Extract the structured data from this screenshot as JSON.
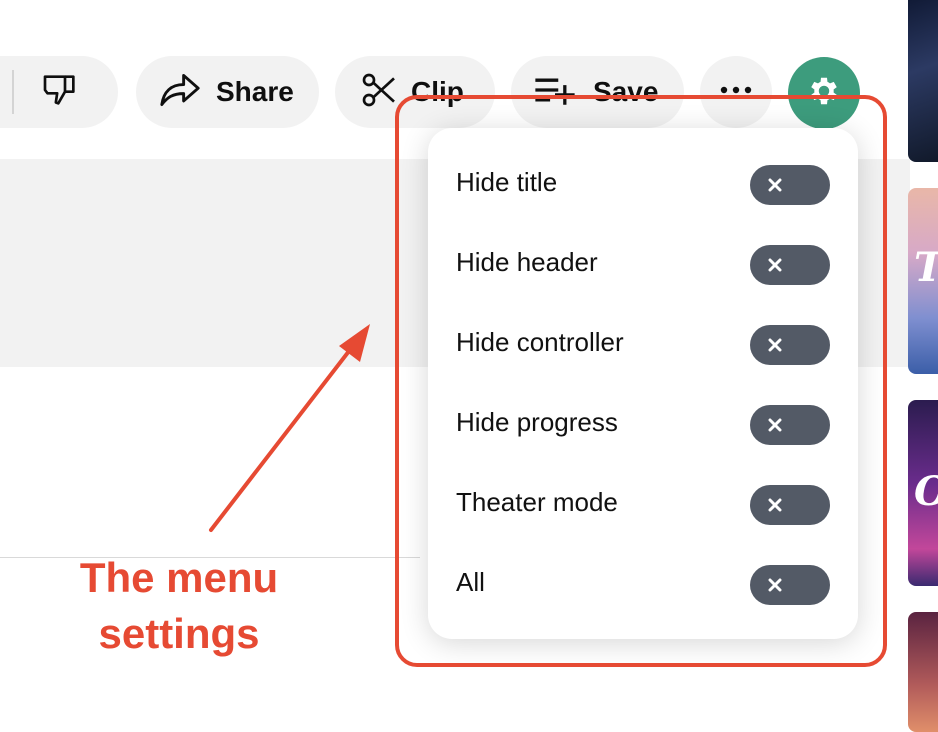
{
  "toolbar": {
    "share_label": "Share",
    "clip_label": "Clip",
    "save_label": "Save"
  },
  "thumbnails": [
    {
      "text": ""
    },
    {
      "text": "T"
    },
    {
      "text": "O"
    },
    {
      "text": ""
    }
  ],
  "menu": {
    "items": [
      {
        "label": "Hide title",
        "enabled": false
      },
      {
        "label": "Hide header",
        "enabled": false
      },
      {
        "label": "Hide controller",
        "enabled": false
      },
      {
        "label": "Hide progress",
        "enabled": false
      },
      {
        "label": "Theater mode",
        "enabled": false
      },
      {
        "label": "All",
        "enabled": false
      }
    ]
  },
  "annotation": {
    "line1": "The menu",
    "line2": "settings"
  },
  "colors": {
    "accent": "#3d9c7d",
    "annotation": "#e64a33",
    "toggle_off": "#535a66"
  }
}
